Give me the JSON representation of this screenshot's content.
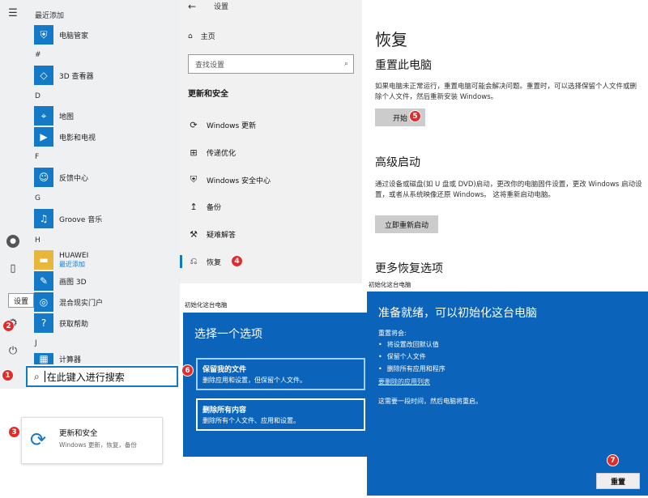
{
  "start_menu": {
    "section_recent": "最近添加",
    "apps": [
      {
        "letter": "",
        "name": "电脑管家",
        "icon": "shield-icon"
      },
      {
        "letter": "#",
        "name": "3D 查看器",
        "icon": "cube-icon"
      },
      {
        "letter": "D",
        "name": "地图",
        "icon": "map-icon"
      },
      {
        "letter": "",
        "name": "电影和电视",
        "icon": "film-icon"
      },
      {
        "letter": "F",
        "name": "反馈中心",
        "icon": "person-icon"
      },
      {
        "letter": "G",
        "name": "Groove 音乐",
        "icon": "music-icon"
      },
      {
        "letter": "H",
        "name": "HUAWEI",
        "sub": "最近添加",
        "icon": "folder-icon"
      },
      {
        "letter": "",
        "name": "画图 3D",
        "icon": "palette-icon"
      },
      {
        "letter": "",
        "name": "混合现实门户",
        "icon": "headset-icon"
      },
      {
        "letter": "",
        "name": "获取帮助",
        "icon": "help-icon"
      },
      {
        "letter": "J",
        "name": "计算器",
        "icon": "calculator-icon"
      }
    ],
    "tooltip": "设置"
  },
  "search": {
    "text": "在此键入进行搜索"
  },
  "result_tile": {
    "title": "更新和安全",
    "subtitle": "Windows 更新，恢复，备份"
  },
  "settings": {
    "app_title": "设置",
    "home": "主页",
    "search_placeholder": "查找设置",
    "section": "更新和安全",
    "nav": [
      {
        "label": "Windows 更新",
        "icon": "sync-icon"
      },
      {
        "label": "传递优化",
        "icon": "delivery-icon"
      },
      {
        "label": "Windows 安全中心",
        "icon": "shield-icon"
      },
      {
        "label": "备份",
        "icon": "backup-icon"
      },
      {
        "label": "疑难解答",
        "icon": "wrench-icon"
      },
      {
        "label": "恢复",
        "icon": "recovery-icon"
      }
    ]
  },
  "recovery": {
    "title": "恢复",
    "reset_heading": "重置此电脑",
    "reset_desc": "如果电脑未正常运行，重置电脑可能会解决问题。重置时，可以选择保留个人文件或删除个人文件，然后重新安装 Windows。",
    "start_button": "开始",
    "advanced_heading": "高级启动",
    "advanced_desc": "通过设备或磁盘(如 U 盘或 DVD)启动，更改你的电脑固件设置，更改 Windows 启动设置，或者从系统映像还原 Windows。 这将重新启动电脑。",
    "restart_button": "立即重新启动",
    "more_heading": "更多恢复选项"
  },
  "choose_dialog": {
    "window_title": "初始化这台电脑",
    "heading": "选择一个选项",
    "options": [
      {
        "title": "保留我的文件",
        "desc": "删除应用和设置，但保留个人文件。"
      },
      {
        "title": "删除所有内容",
        "desc": "删除所有个人文件、应用和设置。"
      }
    ]
  },
  "ready_dialog": {
    "window_title": "初始化这台电脑",
    "heading": "准备就绪，可以初始化这台电脑",
    "lead": "重置将会:",
    "items": [
      "将设置改回默认值",
      "保留个人文件",
      "删除所有应用和程序"
    ],
    "link": "要删除的应用列表",
    "note": "这需要一段时间，然后电脑将重启。",
    "reset_button": "重置"
  },
  "steps": [
    "1",
    "2",
    "3",
    "4",
    "5",
    "6",
    "7"
  ],
  "colors": {
    "accent": "#1479c7",
    "dialog_blue": "#0b64ba",
    "badge_red": "#e22b2b"
  }
}
